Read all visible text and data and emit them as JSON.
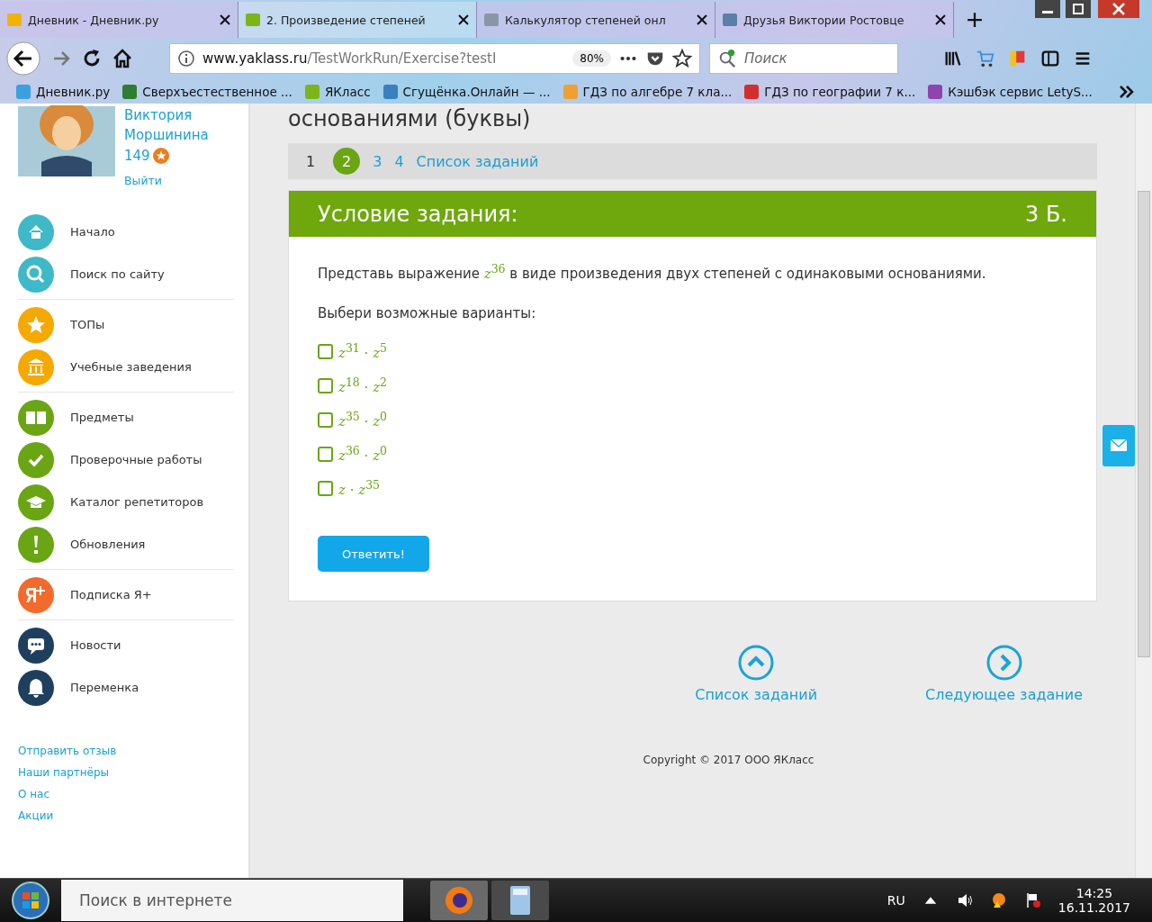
{
  "browser": {
    "tabs": [
      {
        "title": "Дневник - Дневник.ру",
        "selected": false,
        "color": "#f0b400"
      },
      {
        "title": "2. Произведение степеней",
        "selected": true,
        "color": "#7cb518"
      },
      {
        "title": "Калькулятор степеней онл",
        "selected": false,
        "color": "#8a96a8"
      },
      {
        "title": "Друзья Виктории Ростовце",
        "selected": false,
        "color": "#5b7fa6"
      }
    ],
    "url_host": "www.yaklass.ru",
    "url_path": "/TestWorkRun/Exercise?testI",
    "zoom": "80%",
    "search_placeholder": "Поиск",
    "bookmarks": [
      {
        "title": "Дневник.ру",
        "color": "#3aa0e0"
      },
      {
        "title": "Сверхъестественное ...",
        "color": "#2e7d32"
      },
      {
        "title": "ЯКласс",
        "color": "#7cb518"
      },
      {
        "title": "Сгущёнка.Онлайн — ...",
        "color": "#3a7fc0"
      },
      {
        "title": "ГДЗ по алгебре 7 кла...",
        "color": "#f0a030"
      },
      {
        "title": "ГДЗ по географии 7 к...",
        "color": "#d32f2f"
      },
      {
        "title": "Кэшбэк сервис LetyS...",
        "color": "#8e44ad"
      }
    ]
  },
  "user": {
    "first_name": "Виктория",
    "last_name": "Моршинина",
    "points": "149",
    "logout": "Выйти"
  },
  "menu": [
    [
      {
        "label": "Начало",
        "kind": "home",
        "color": "#3fb8c8"
      },
      {
        "label": "Поиск по сайту",
        "kind": "search",
        "color": "#3fb8c8"
      }
    ],
    [
      {
        "label": "ТОПы",
        "kind": "star",
        "color": "#f5a800"
      },
      {
        "label": "Учебные заведения",
        "kind": "school",
        "color": "#f5a800"
      }
    ],
    [
      {
        "label": "Предметы",
        "kind": "book",
        "color": "#6aa514"
      },
      {
        "label": "Проверочные работы",
        "kind": "check",
        "color": "#6aa514"
      },
      {
        "label": "Каталог репетиторов",
        "kind": "cap",
        "color": "#6aa514"
      },
      {
        "label": "Обновления",
        "kind": "alert",
        "color": "#6aa514"
      }
    ],
    [
      {
        "label": "Подписка Я+",
        "kind": "ya",
        "color": "#f26b2c"
      }
    ],
    [
      {
        "label": "Новости",
        "kind": "chat",
        "color": "#1f3f5f"
      },
      {
        "label": "Переменка",
        "kind": "bell",
        "color": "#1f3f5f"
      }
    ]
  ],
  "footer_links": [
    "Отправить отзыв",
    "Наши партнёры",
    "О нас",
    "Акции"
  ],
  "page_title": "основаниями (буквы)",
  "pagination": [
    {
      "label": "1",
      "selected": false,
      "kind": "plain"
    },
    {
      "label": "2",
      "selected": true,
      "kind": "link"
    },
    {
      "label": "3",
      "selected": false,
      "kind": "link"
    },
    {
      "label": "4",
      "selected": false,
      "kind": "link"
    },
    {
      "label": "Список заданий",
      "selected": false,
      "kind": "link"
    }
  ],
  "task": {
    "header": "Условие задания:",
    "score": "3 Б.",
    "statement_before": "Представь выражение",
    "expression": "*z*$^{36}$",
    "statement_after": "в виде произведения двух степеней с одинаковыми основаниями.",
    "prompt": "Выбери возможные варианты:",
    "options": [
      {
        "text": "*z*$^{31}$ · *z*$^{5}$",
        "checked": false
      },
      {
        "text": "*z*$^{18}$ · *z*$^{2}$",
        "checked": false
      },
      {
        "text": "*z*$^{35}$ · *z*$^{0}$",
        "checked": false
      },
      {
        "text": "*z*$^{36}$ · *z*$^{0}$",
        "checked": false
      },
      {
        "text": "*z* · *z*$^{35}$",
        "checked": false
      }
    ],
    "submit": "Ответить!"
  },
  "nav": {
    "list": "Список заданий",
    "next": "Следующее задание"
  },
  "copyright": "Copyright © 2017 ООО ЯКласс",
  "taskbar": {
    "search_placeholder": "Поиск в интернете",
    "language": "RU",
    "time": "14:25",
    "date": "16.11.2017"
  }
}
